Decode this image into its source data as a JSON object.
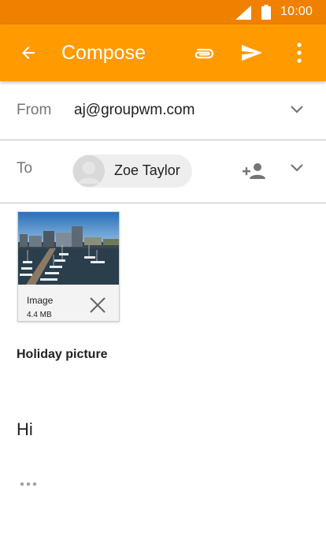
{
  "status_bar": {
    "time": "10:00",
    "signal_icon": "signal-icon",
    "battery_icon": "battery-icon"
  },
  "app_bar": {
    "title": "Compose",
    "back_icon": "arrow-back-icon",
    "attach_icon": "paperclip-icon",
    "send_icon": "send-icon",
    "more_icon": "more-vert-icon",
    "background": "#ff9a00",
    "status_background": "#f08000"
  },
  "from": {
    "label": "From",
    "value": "aj@groupwm.com"
  },
  "to": {
    "label": "To",
    "recipients": [
      {
        "name": "Zoe Taylor"
      }
    ]
  },
  "attachment": {
    "title": "Image",
    "size": "4.4 MB"
  },
  "subject": "Holiday picture",
  "body": "Hi"
}
